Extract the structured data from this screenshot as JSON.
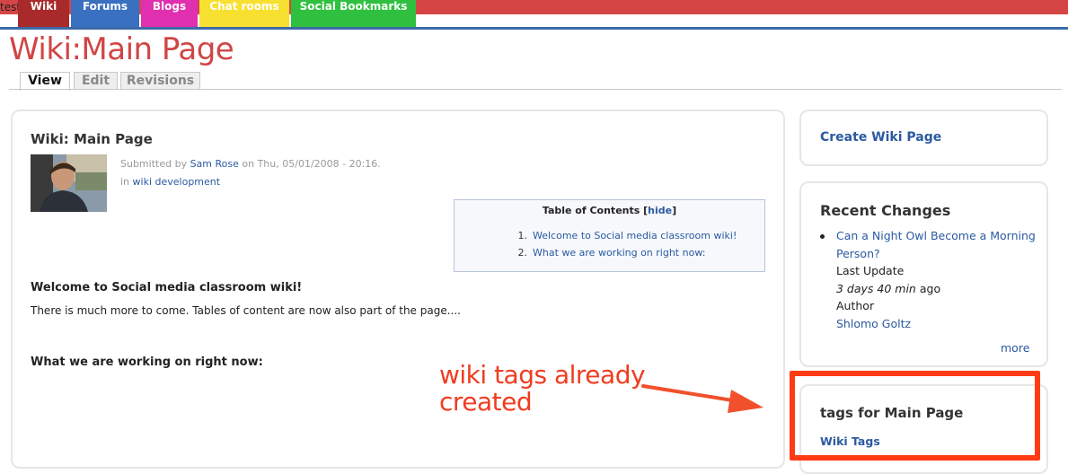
{
  "top": {
    "test_label": "test"
  },
  "nav": {
    "items": [
      {
        "label": "Wiki",
        "color": "#a82a2a"
      },
      {
        "label": "Forums",
        "color": "#3a70c0"
      },
      {
        "label": "Blogs",
        "color": "#e030b0"
      },
      {
        "label": "Chat rooms",
        "color": "#f8e030"
      },
      {
        "label": "Social Bookmarks",
        "color": "#30c040"
      }
    ]
  },
  "page": {
    "title": "Wiki:Main Page"
  },
  "tabs": [
    {
      "label": "View",
      "active": true
    },
    {
      "label": "Edit",
      "active": false
    },
    {
      "label": "Revisions",
      "active": false
    }
  ],
  "content": {
    "title": "Wiki: Main Page",
    "submitted_prefix": "Submitted by",
    "author": "Sam Rose",
    "submitted_suffix": "on Thu, 05/01/2008 - 20:16.",
    "in_prefix": "in",
    "category": "wiki development",
    "toc": {
      "title": "Table of Contents",
      "hide_open": "[",
      "hide_label": "hide",
      "hide_close": "]",
      "items": [
        {
          "num": "1.",
          "label": "Welcome to Social media classroom wiki!"
        },
        {
          "num": "2.",
          "label": "What we are working on right now:"
        }
      ]
    },
    "section1_heading": "Welcome to Social media classroom wiki!",
    "section1_text": "There is much more to come. Tables of content are now also part of the page....",
    "section2_heading": "What we are working on right now:"
  },
  "sidebar": {
    "create_link": "Create Wiki Page",
    "recent": {
      "title": "Recent Changes",
      "item_link": "Can a Night Owl Become a Morning Person?",
      "last_update_label": "Last Update",
      "last_update_value": "3 days 40 min",
      "last_update_suffix": "ago",
      "author_label": "Author",
      "author_name": "Shlomo Goltz",
      "more": "more"
    },
    "tags": {
      "title": "tags for Main Page",
      "link": "Wiki Tags"
    }
  },
  "annotation": {
    "line1": "wiki tags already",
    "line2": "created",
    "color": "#ff3b14"
  }
}
